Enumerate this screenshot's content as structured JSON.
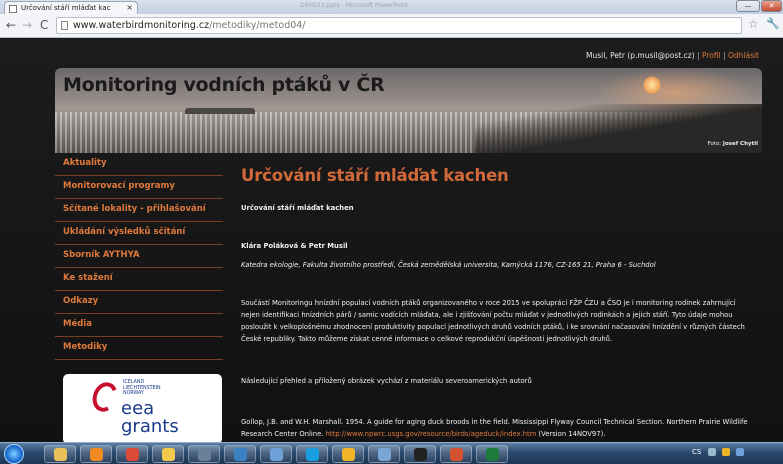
{
  "browser": {
    "tab_title": "Určování stáří mláďat kac",
    "tab_close": "×",
    "background_window_title": "DSH023.pptx - Microsoft PowerPoint",
    "url_host": "www.waterbirdmonitoring.cz",
    "url_path": "/metodiky/metod04/",
    "icons": {
      "back": "back-arrow-icon",
      "forward": "forward-arrow-icon",
      "reload": "reload-icon",
      "star": "bookmark-star-icon",
      "wrench": "wrench-icon"
    }
  },
  "userbar": {
    "user": "Musil, Petr (p.musil@post.cz)",
    "separator": "|",
    "profile": "Profil",
    "logout": "Odhlásit"
  },
  "banner": {
    "title": "Monitoring vodních ptáků v ČR",
    "credit_label": "Foto:",
    "credit_name": "Josef Chytil"
  },
  "sidebar": {
    "items": [
      {
        "label": "Aktuality"
      },
      {
        "label": "Monitorovací programy"
      },
      {
        "label": "Sčítané lokality - přihlašování"
      },
      {
        "label": "Ukládání výsledků sčítání"
      },
      {
        "label": "Sborník AYTHYA"
      },
      {
        "label": "Ke stažení"
      },
      {
        "label": "Odkazy"
      },
      {
        "label": "Média"
      },
      {
        "label": "Metodiky"
      }
    ],
    "logo": {
      "countries": [
        "ICELAND",
        "LIECHTENSTEIN",
        "NORWAY"
      ],
      "word1": "eea",
      "word2": "grants"
    }
  },
  "content": {
    "title": "Určování stáří mláďat kachen",
    "subtitle": "Určování stáří mláďat kachen",
    "authors": "Klára Poláková  & Petr Musil",
    "affiliation": "Katedra ekologie, Fakulta životního prostředí, Česká zemědělská universita, Kamýcká 1176, CZ-165 21, Praha 6 - Suchdol",
    "paragraph1": "Součástí Monitoringu hnízdní populací vodních ptáků organizovaného v roce 2015 ve spolupráci FŽP ČZU a ČSO je i monitoring rodinek zahrnující nejen identifikaci hnízdních párů / samic vodících mláďata, ale i zjišťování počtu mláďat v jednotlivých rodinkách a jejich stáří. Tyto údaje mohou posloužit k velkoplošnému zhodnocení produktivity populací jednotlivých druhů vodních ptáků, i ke srovnání načasování hnízdění v různých částech České republiky. Takto můžeme získat cenné informace o celkové reprodukční úspěšnosti jednotlivých druhů.",
    "paragraph2": "Následující přehled a přiložený obrázek vychází z materiálu severoamerických autorů",
    "reference_text": "Gollop, J.B. and W.H. Marshall. 1954. A guide for aging duck broods in the field. Mississippi Flyway Council Technical Section. Northern Prairie Wildlife Research Center Online. ",
    "reference_link": "http://www.npwrc.usgs.gov/resource/birds/ageduck/index.htm",
    "reference_suffix": " (Version 14NOV97)."
  },
  "taskbar": {
    "apps": [
      {
        "name": "explorer-icon",
        "color": "#e8c15a"
      },
      {
        "name": "media-player-icon",
        "color": "#f08a24"
      },
      {
        "name": "chrome-icon",
        "color": "#d94a38"
      },
      {
        "name": "folder-icon",
        "color": "#f2c94c"
      },
      {
        "name": "calculator-icon",
        "color": "#6a7f99"
      },
      {
        "name": "globe-icon",
        "color": "#3b82c4"
      },
      {
        "name": "app-icon",
        "color": "#6fa0d8"
      },
      {
        "name": "skype-icon",
        "color": "#1aa0e0"
      },
      {
        "name": "settings-icon",
        "color": "#f0b429"
      },
      {
        "name": "monitor-icon",
        "color": "#7aa6d6"
      },
      {
        "name": "terminal-icon",
        "color": "#222222"
      },
      {
        "name": "powerpoint-icon",
        "color": "#d35230"
      },
      {
        "name": "excel-icon",
        "color": "#1f7a3e"
      }
    ],
    "tray_lang": "CS"
  }
}
